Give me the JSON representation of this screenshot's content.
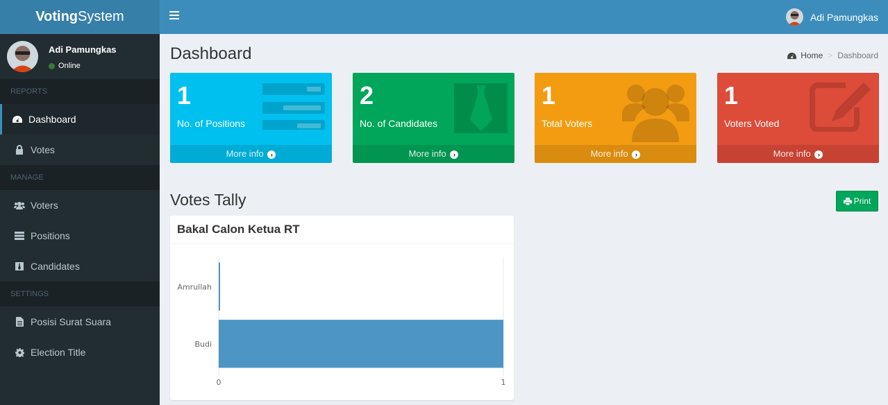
{
  "brand": {
    "bold": "Voting",
    "rest": "System"
  },
  "navbar": {
    "user_name": "Adi Pamungkas"
  },
  "sidebar": {
    "user": {
      "name": "Adi Pamungkas",
      "status": "Online"
    },
    "sections": {
      "reports": "REPORTS",
      "manage": "MANAGE",
      "settings": "SETTINGS"
    },
    "items": {
      "dashboard": "Dashboard",
      "votes": "Votes",
      "voters": "Voters",
      "positions": "Positions",
      "candidates": "Candidates",
      "posisi": "Posisi Surat Suara",
      "election_title": "Election Title"
    }
  },
  "page": {
    "title": "Dashboard",
    "breadcrumb": {
      "home": "Home",
      "current": "Dashboard"
    }
  },
  "stats": [
    {
      "number": "1",
      "label": "No. of Positions",
      "more": "More info"
    },
    {
      "number": "2",
      "label": "No. of Candidates",
      "more": "More info"
    },
    {
      "number": "1",
      "label": "Total Voters",
      "more": "More info"
    },
    {
      "number": "1",
      "label": "Voters Voted",
      "more": "More info"
    }
  ],
  "tally": {
    "title": "Votes Tally",
    "print_label": "Print"
  },
  "chart_data": {
    "type": "bar",
    "orientation": "horizontal",
    "title": "Bakal Calon Ketua RT",
    "categories": [
      "Amrullah",
      "Budi"
    ],
    "values": [
      0,
      1
    ],
    "xlim": [
      0,
      1
    ],
    "xticks": [
      "0",
      "1"
    ],
    "color": "#4d95c4"
  }
}
